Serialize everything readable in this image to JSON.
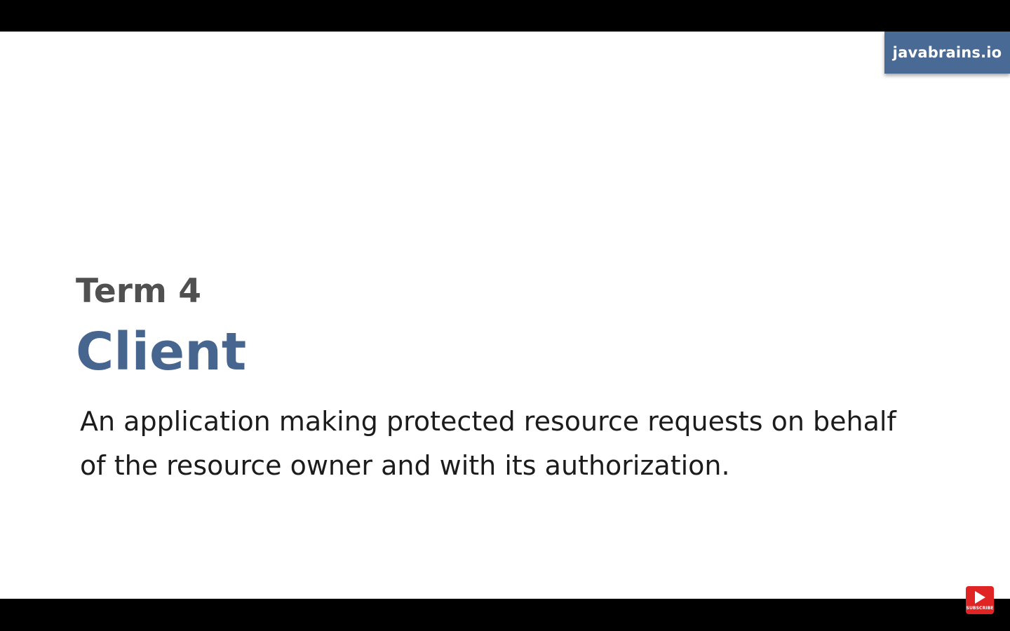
{
  "brand": {
    "label": "javabrains.io",
    "color": "#4a6a96"
  },
  "slide": {
    "term_number": "Term 4",
    "term_title": "Client",
    "definition": "An application making protected resource requests on behalf of the resource owner and with its authorization.",
    "title_color": "#46658f",
    "label_color": "#505050"
  },
  "overlay": {
    "subscribe_label": "SUBSCRIBE",
    "subscribe_icon": "play-icon",
    "subscribe_color": "#e02424"
  }
}
